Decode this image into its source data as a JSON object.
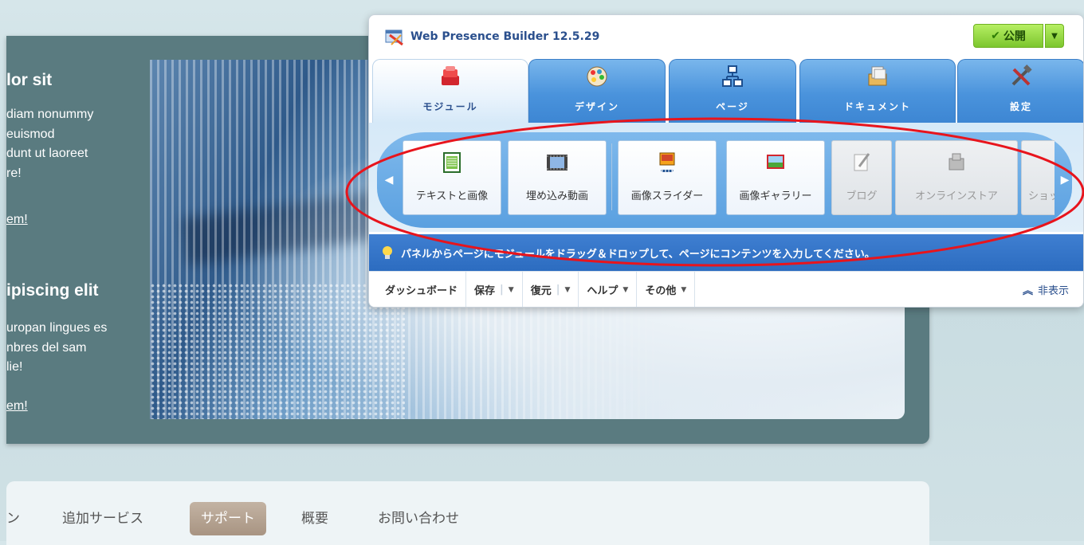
{
  "site": {
    "heading1": "lor sit",
    "para1": "diam nonummy\n euismod\ndunt ut laoreet\nre!",
    "link1": "em!",
    "heading2": "ipiscing elit",
    "para2": "uropan lingues es\nnbres del sam\nlie!",
    "link2": "em!",
    "nav": [
      "ン",
      "追加サービス",
      "サポート",
      "概要",
      "お問い合わせ"
    ],
    "nav_active_index": 2
  },
  "wpb": {
    "title": "Web Presence Builder 12.5.29",
    "publish_label": "公開",
    "tabs": [
      {
        "label": "モジュール",
        "icon": "modules-icon",
        "active": true
      },
      {
        "label": "デザイン",
        "icon": "palette-icon",
        "active": false
      },
      {
        "label": "ページ",
        "icon": "sitemap-icon",
        "active": false
      },
      {
        "label": "ドキュメント",
        "icon": "documents-icon",
        "active": false
      },
      {
        "label": "設定",
        "icon": "tools-icon",
        "active": false
      }
    ],
    "modules": [
      {
        "label": "テキストと画像",
        "icon": "text-image-icon",
        "enabled": true
      },
      {
        "label": "埋め込み動画",
        "icon": "video-icon",
        "enabled": true
      },
      {
        "label": "画像スライダー",
        "icon": "image-slider-icon",
        "enabled": true
      },
      {
        "label": "画像ギャラリー",
        "icon": "image-gallery-icon",
        "enabled": true
      },
      {
        "label": "ブログ",
        "icon": "blog-icon",
        "enabled": false
      },
      {
        "label": "オンラインストア",
        "icon": "online-store-icon",
        "enabled": false
      },
      {
        "label": "ショッピ",
        "icon": "shopping-icon",
        "enabled": false
      }
    ],
    "hint": "パネルからページにモジュールをドラッグ＆ドロップして、ページにコンテンツを入力してください。",
    "bottom": {
      "dashboard": "ダッシュボード",
      "save": "保存",
      "restore": "復元",
      "help": "ヘルプ",
      "other": "その他",
      "hide": "非表示"
    }
  },
  "colors": {
    "accent_blue": "#3d86d3",
    "publish_green": "#7cc62e",
    "annotation_red": "#e8141c"
  }
}
